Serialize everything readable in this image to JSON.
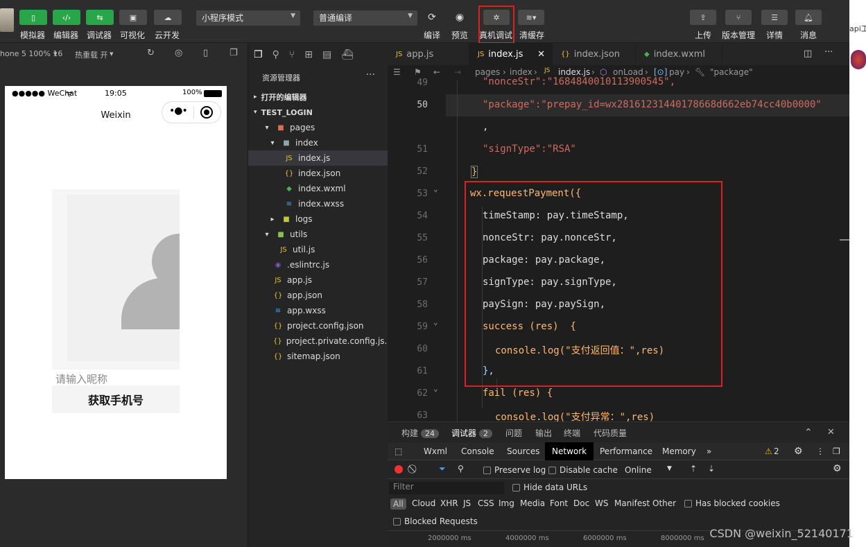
{
  "toolbar": {
    "buttons": [
      {
        "label": "模拟器",
        "icon": "phone-icon"
      },
      {
        "label": "编辑器",
        "icon": "code-icon"
      },
      {
        "label": "调试器",
        "icon": "debug-icon"
      },
      {
        "label": "可视化",
        "icon": "layout-icon"
      },
      {
        "label": "云开发",
        "icon": "cloud-icon"
      }
    ],
    "mode_select": "小程序模式",
    "compile_select": "普通编译",
    "compile_label": "编译",
    "preview_label": "预览",
    "real_debug_label": "真机调试",
    "clear_cache_label": "清缓存",
    "upload_label": "上传",
    "version_label": "版本管理",
    "details_label": "详情",
    "messages_label": "消息"
  },
  "simulator": {
    "device": "hone 5 100% 16",
    "hot_reload": "热重载 开",
    "status_left": "●●●●● WeChat",
    "status_time": "19:05",
    "status_battery": "100%",
    "nav_title": "Weixin",
    "nickname_placeholder": "请输入昵称",
    "phone_button": "获取手机号"
  },
  "explorer": {
    "title": "资源管理器",
    "open_editors": "打开的编辑器",
    "project": "TEST_LOGIN",
    "items": [
      {
        "name": "pages",
        "icon": "folder-icon"
      },
      {
        "name": "index",
        "icon": "folder-icon"
      },
      {
        "name": "index.js",
        "icon": "js-file-icon"
      },
      {
        "name": "index.json",
        "icon": "json-file-icon"
      },
      {
        "name": "index.wxml",
        "icon": "wxml-file-icon"
      },
      {
        "name": "index.wxss",
        "icon": "wxss-file-icon"
      },
      {
        "name": "logs",
        "icon": "folder-icon"
      },
      {
        "name": "utils",
        "icon": "folder-icon"
      },
      {
        "name": "util.js",
        "icon": "js-file-icon"
      },
      {
        "name": ".eslintrc.js",
        "icon": "eslint-icon"
      },
      {
        "name": "app.js",
        "icon": "js-file-icon"
      },
      {
        "name": "app.json",
        "icon": "json-file-icon"
      },
      {
        "name": "app.wxss",
        "icon": "wxss-file-icon"
      },
      {
        "name": "project.config.json",
        "icon": "json-file-icon"
      },
      {
        "name": "project.private.config.js...",
        "icon": "json-file-icon"
      },
      {
        "name": "sitemap.json",
        "icon": "json-file-icon"
      }
    ]
  },
  "editor": {
    "tabs": [
      {
        "name": "app.js",
        "active": false
      },
      {
        "name": "index.js",
        "active": true
      },
      {
        "name": "index.json",
        "active": false
      },
      {
        "name": "index.wxml",
        "active": false
      }
    ],
    "breadcrumb": [
      "pages",
      "index",
      "index.js",
      "onLoad",
      "pay",
      "\"package\""
    ],
    "line_numbers": [
      "49",
      "50",
      "",
      "51",
      "52",
      "53",
      "54",
      "55",
      "56",
      "57",
      "58",
      "59",
      "60",
      "61",
      "62",
      "63"
    ],
    "lines": [
      "\"nonceStr\":\"1684840010113900545\",",
      "\"package\":\"prepay_id=wx28161231440178668d662eb74cc40b0000\"",
      ",",
      "\"signType\":\"RSA\"",
      "}",
      "wx.requestPayment({",
      "timeStamp: pay.timeStamp,",
      "nonceStr: pay.nonceStr,",
      "package: pay.package,",
      "signType: pay.signType,",
      "paySign: pay.paySign,",
      "success (res)  {",
      "console.log(\"支付返回值：\",res)",
      "},",
      "fail (res) {",
      "console.log(\"支付异常：\",res)"
    ]
  },
  "panel": {
    "tabs": [
      "构建",
      "调试器",
      "问题",
      "输出",
      "终端",
      "代码质量"
    ],
    "build_badge": "24",
    "debugger_badge": "2",
    "devtools_tabs": [
      "Wxml",
      "Console",
      "Sources",
      "Network",
      "Performance",
      "Memory"
    ],
    "warnings": "2",
    "preserve_log": "Preserve log",
    "disable_cache": "Disable cache",
    "throttle": "Online",
    "filter_placeholder": "Filter",
    "hide_data_urls": "Hide data URLs",
    "types": [
      "All",
      "Cloud",
      "XHR",
      "JS",
      "CSS",
      "Img",
      "Media",
      "Font",
      "Doc",
      "WS",
      "Manifest",
      "Other"
    ],
    "blocked_cookies": "Has blocked cookies",
    "blocked_requests": "Blocked Requests",
    "timeline": [
      "2000000 ms",
      "4000000 ms",
      "6000000 ms",
      "8000000 ms"
    ]
  },
  "watermark": "CSDN @weixin_52140171",
  "right_edge_text": "api工"
}
